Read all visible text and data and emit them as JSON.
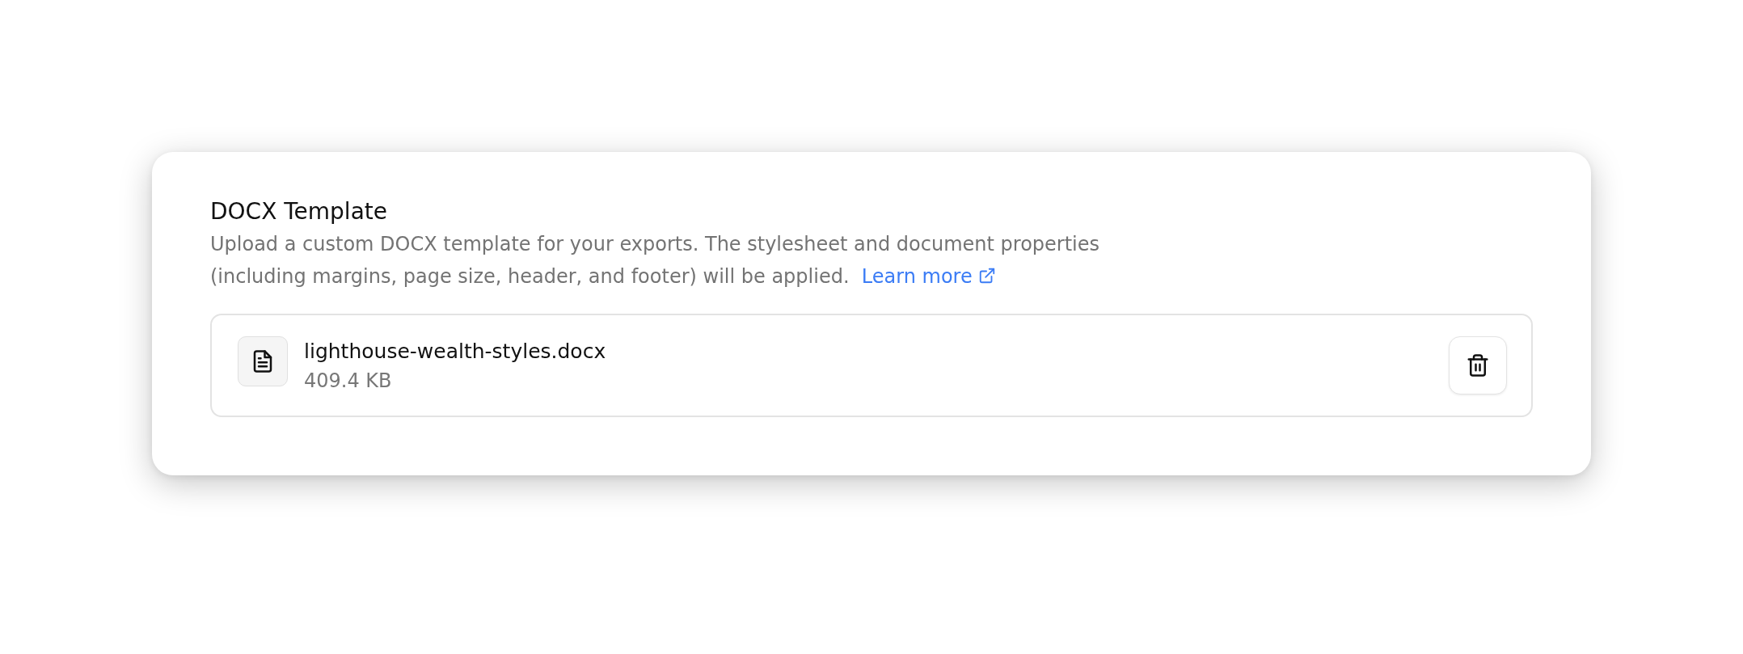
{
  "section": {
    "title": "DOCX Template",
    "description": "Upload a custom DOCX template for your exports. The stylesheet and document properties (including margins, page size, header, and footer) will be applied.",
    "link": "Learn more"
  },
  "file": {
    "name": "lighthouse-wealth-styles.docx",
    "size": "409.4 KB"
  }
}
